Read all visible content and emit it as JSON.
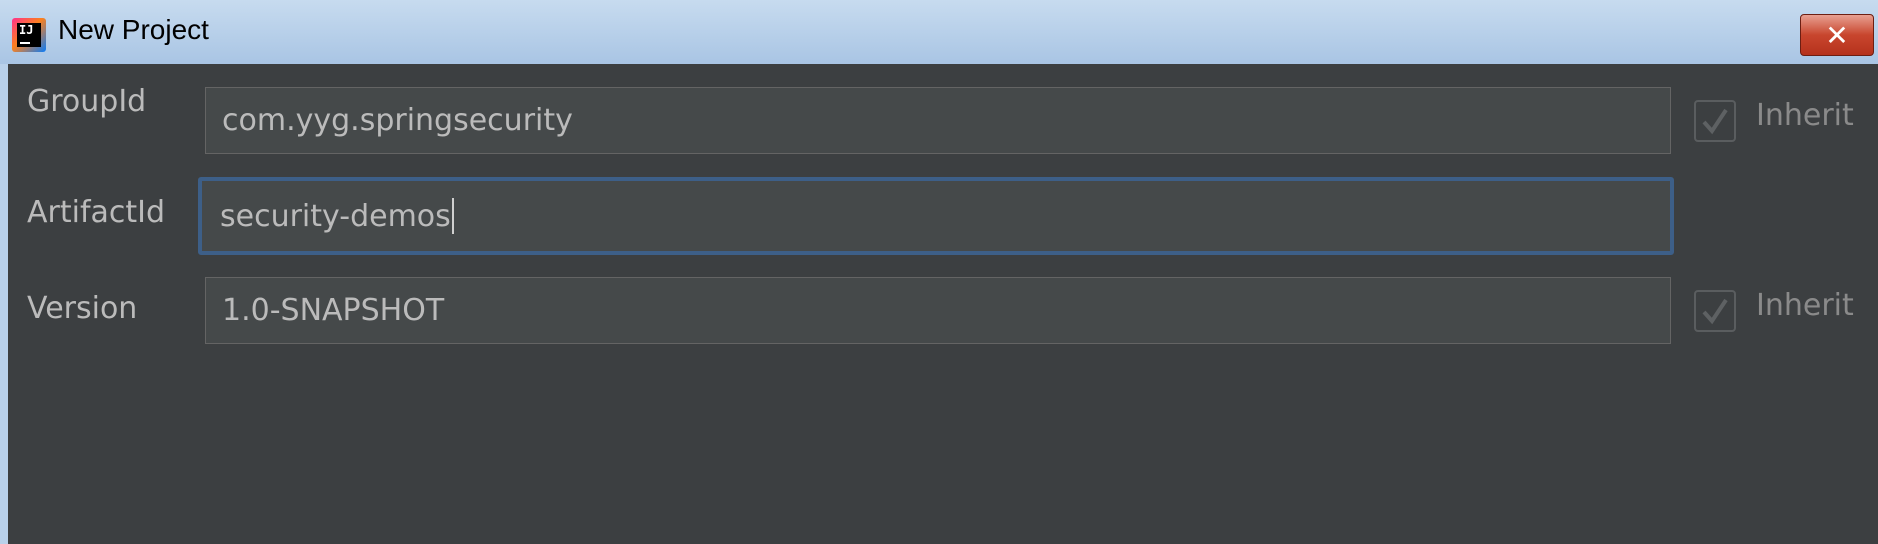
{
  "window": {
    "title": "New Project",
    "close_label": "✕",
    "logo_text": "IJ"
  },
  "form": {
    "group_id": {
      "label": "GroupId",
      "value": "com.yyg.springsecurity",
      "inherit_label": "Inherit",
      "inherit_checked": true
    },
    "artifact_id": {
      "label": "ArtifactId",
      "value": "security-demos"
    },
    "version": {
      "label": "Version",
      "value": "1.0-SNAPSHOT",
      "inherit_label": "Inherit",
      "inherit_checked": true
    }
  },
  "colors": {
    "background": "#3c3f41",
    "field_bg": "#45494a",
    "focus_border": "#3d5f88",
    "label_text": "#bbbbbb"
  }
}
